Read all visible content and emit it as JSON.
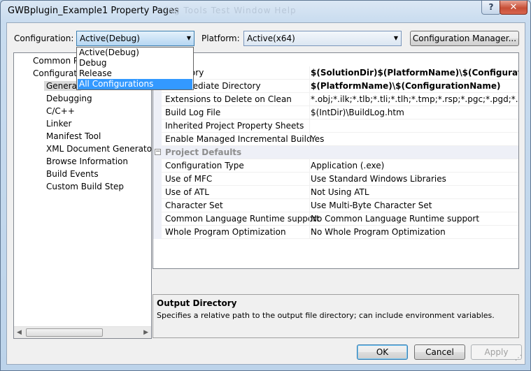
{
  "window": {
    "title": "GWBplugin_Example1 Property Pages",
    "background_menu_text": "ing   Tools   Test   Window   Help",
    "help_label": "?",
    "close_label": "✕"
  },
  "toolbar": {
    "configuration_label": "Configuration:",
    "configuration_value": "Active(Debug)",
    "platform_label": "Platform:",
    "platform_value": "Active(x64)",
    "config_manager_label": "Configuration Manager..."
  },
  "configuration_dropdown": {
    "options": [
      "Active(Debug)",
      "Debug",
      "Release",
      "All Configurations"
    ],
    "highlighted": "All Configurations"
  },
  "tree": {
    "items": [
      {
        "label": "Common Pr"
      },
      {
        "label": "Configuratio"
      },
      {
        "label": "General"
      },
      {
        "label": "Debugging"
      },
      {
        "label": "C/C++"
      },
      {
        "label": "Linker"
      },
      {
        "label": "Manifest Tool"
      },
      {
        "label": "XML Document Generator"
      },
      {
        "label": "Browse Information"
      },
      {
        "label": "Build Events"
      },
      {
        "label": "Custom Build Step"
      }
    ]
  },
  "property_grid": {
    "rows": [
      {
        "name": "Directory",
        "value": "$(SolutionDir)$(PlatformName)\\$(ConfigurationName",
        "bold": true
      },
      {
        "name": "Intermediate Directory",
        "value": "$(PlatformName)\\$(ConfigurationName)",
        "bold": true
      },
      {
        "name": "Extensions to Delete on Clean",
        "value": "*.obj;*.ilk;*.tlb;*.tli;*.tlh;*.tmp;*.rsp;*.pgc;*.pgd;*.meta;$(T",
        "bold": false
      },
      {
        "name": "Build Log File",
        "value": "$(IntDir)\\BuildLog.htm",
        "bold": false
      },
      {
        "name": "Inherited Project Property Sheets",
        "value": "",
        "bold": false
      },
      {
        "name": "Enable Managed Incremental Build",
        "value": "Yes",
        "bold": false
      }
    ],
    "category": "Project Defaults",
    "category_toggle": "−",
    "category_rows": [
      {
        "name": "Configuration Type",
        "value": "Application (.exe)"
      },
      {
        "name": "Use of MFC",
        "value": "Use Standard Windows Libraries"
      },
      {
        "name": "Use of ATL",
        "value": "Not Using ATL"
      },
      {
        "name": "Character Set",
        "value": "Use Multi-Byte Character Set"
      },
      {
        "name": "Common Language Runtime support",
        "value": "No Common Language Runtime support"
      },
      {
        "name": "Whole Program Optimization",
        "value": "No Whole Program Optimization"
      }
    ]
  },
  "description": {
    "title": "Output Directory",
    "text": "Specifies a relative path to the output file directory; can include environment variables."
  },
  "buttons": {
    "ok": "OK",
    "cancel": "Cancel",
    "apply": "Apply"
  }
}
